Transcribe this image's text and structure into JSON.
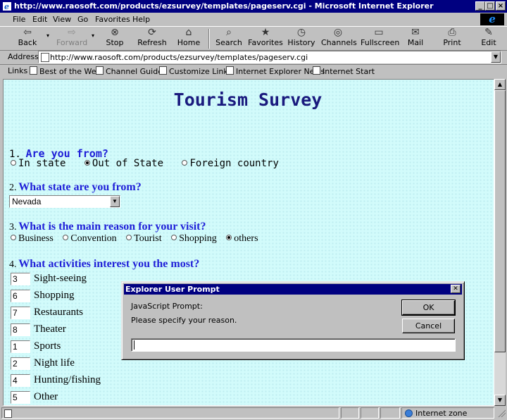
{
  "window": {
    "title": "http://www.raosoft.com/products/ezsurvey/templates/pageserv.cgi - Microsoft Internet Explorer",
    "controls": {
      "minimize": "_",
      "maximize": "□",
      "close": "×"
    }
  },
  "menu": [
    "File",
    "Edit",
    "View",
    "Go",
    "Favorites",
    "Help"
  ],
  "toolbar": {
    "back": "Back",
    "forward": "Forward",
    "stop": "Stop",
    "refresh": "Refresh",
    "home": "Home",
    "search": "Search",
    "favorites": "Favorites",
    "history": "History",
    "channels": "Channels",
    "fullscreen": "Fullscreen",
    "mail": "Mail",
    "print": "Print",
    "edit": "Edit"
  },
  "address": {
    "label": "Address",
    "url": "http://www.raosoft.com/products/ezsurvey/templates/pageserv.cgi"
  },
  "links": {
    "label": "Links",
    "items": [
      "Best of the Web",
      "Channel Guide",
      "Customize Links",
      "Internet Explorer News",
      "Internet Start"
    ]
  },
  "page": {
    "title": "Tourism Survey",
    "q1": {
      "number": "1.",
      "text": "Are you from?",
      "options": [
        "In state",
        "Out of State",
        "Foreign country"
      ],
      "selected": "Out of State"
    },
    "q2": {
      "number": "2.",
      "text": "What state are you from?",
      "value": "Nevada"
    },
    "q3": {
      "number": "3.",
      "text": "What is the main reason for your visit?",
      "options": [
        "Business",
        "Convention",
        "Tourist",
        "Shopping",
        "others"
      ],
      "selected": "others"
    },
    "q4": {
      "number": "4.",
      "text": "What activities interest you the most?",
      "items": [
        {
          "value": "3",
          "label": "Sight-seeing"
        },
        {
          "value": "6",
          "label": "Shopping"
        },
        {
          "value": "7",
          "label": "Restaurants"
        },
        {
          "value": "8",
          "label": "Theater"
        },
        {
          "value": "1",
          "label": "Sports"
        },
        {
          "value": "2",
          "label": "Night life"
        },
        {
          "value": "4",
          "label": "Hunting/fishing"
        },
        {
          "value": "5",
          "label": "Other"
        }
      ]
    }
  },
  "dialog": {
    "title": "Explorer User Prompt",
    "prompt_label": "JavaScript Prompt:",
    "message": "Please specify your reason.",
    "ok": "OK",
    "cancel": "Cancel",
    "input_value": ""
  },
  "status": {
    "zone": "Internet zone"
  }
}
